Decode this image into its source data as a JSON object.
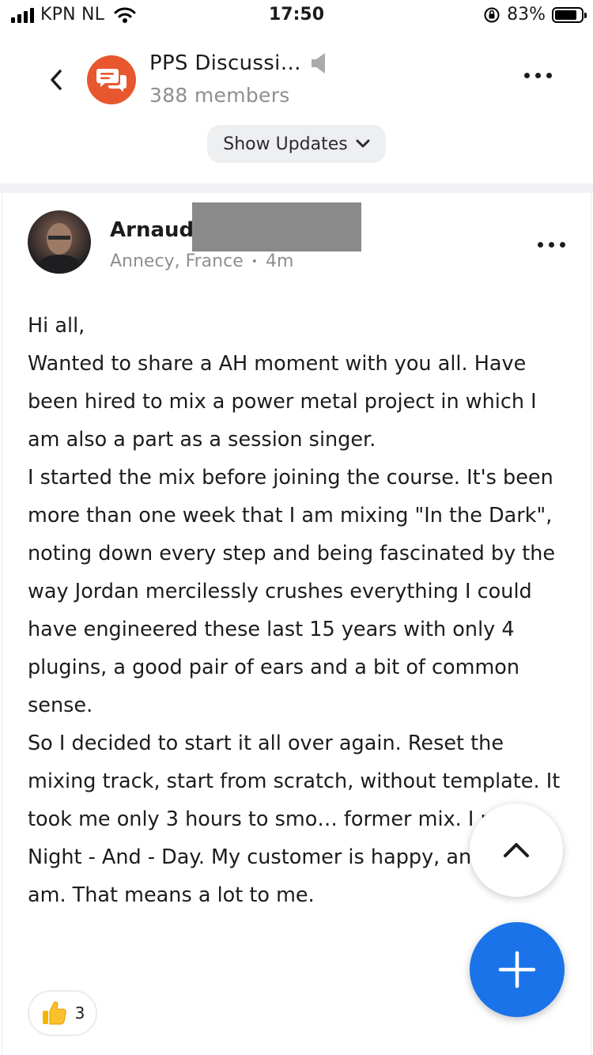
{
  "status_bar": {
    "carrier": "KPN NL",
    "time": "17:50",
    "battery_percent": "83%",
    "battery_level": 0.83
  },
  "header": {
    "group_title": "PPS Discussi…",
    "member_count": "388 members",
    "show_updates_label": "Show Updates",
    "group_icon": "chat-bubbles-icon",
    "accent_color": "#e8572e"
  },
  "post": {
    "author_first_name": "Arnaud",
    "location": "Annecy, France",
    "time_ago": "4m",
    "lines": [
      "Hi all,",
      "Wanted to share a AH moment with you all. Have been hired to mix a power metal project in which I am also a part as a session singer.",
      "I started the mix before joining the course. It's been more than one week that I am mixing \"In the Dark\", noting down every step and being fascinated by the way Jordan mercilessly crushes everything I could have engineered these last 15 years with only 4 plugins, a good pair of ears and a bit of common sense.",
      "So I decided to start it all over again. Reset the mixing track, start from scratch, without template. It took me only 3 hours to smo… former mix. I mean. Night - And - Day. My customer is happy, and I also am. That means a lot to me."
    ],
    "reaction_icon": "thumbs-up-icon",
    "reaction_count": "3"
  },
  "fab": {
    "color": "#1a73e8",
    "icon": "plus-icon"
  },
  "scroll_top": {
    "icon": "chevron-up-icon"
  }
}
